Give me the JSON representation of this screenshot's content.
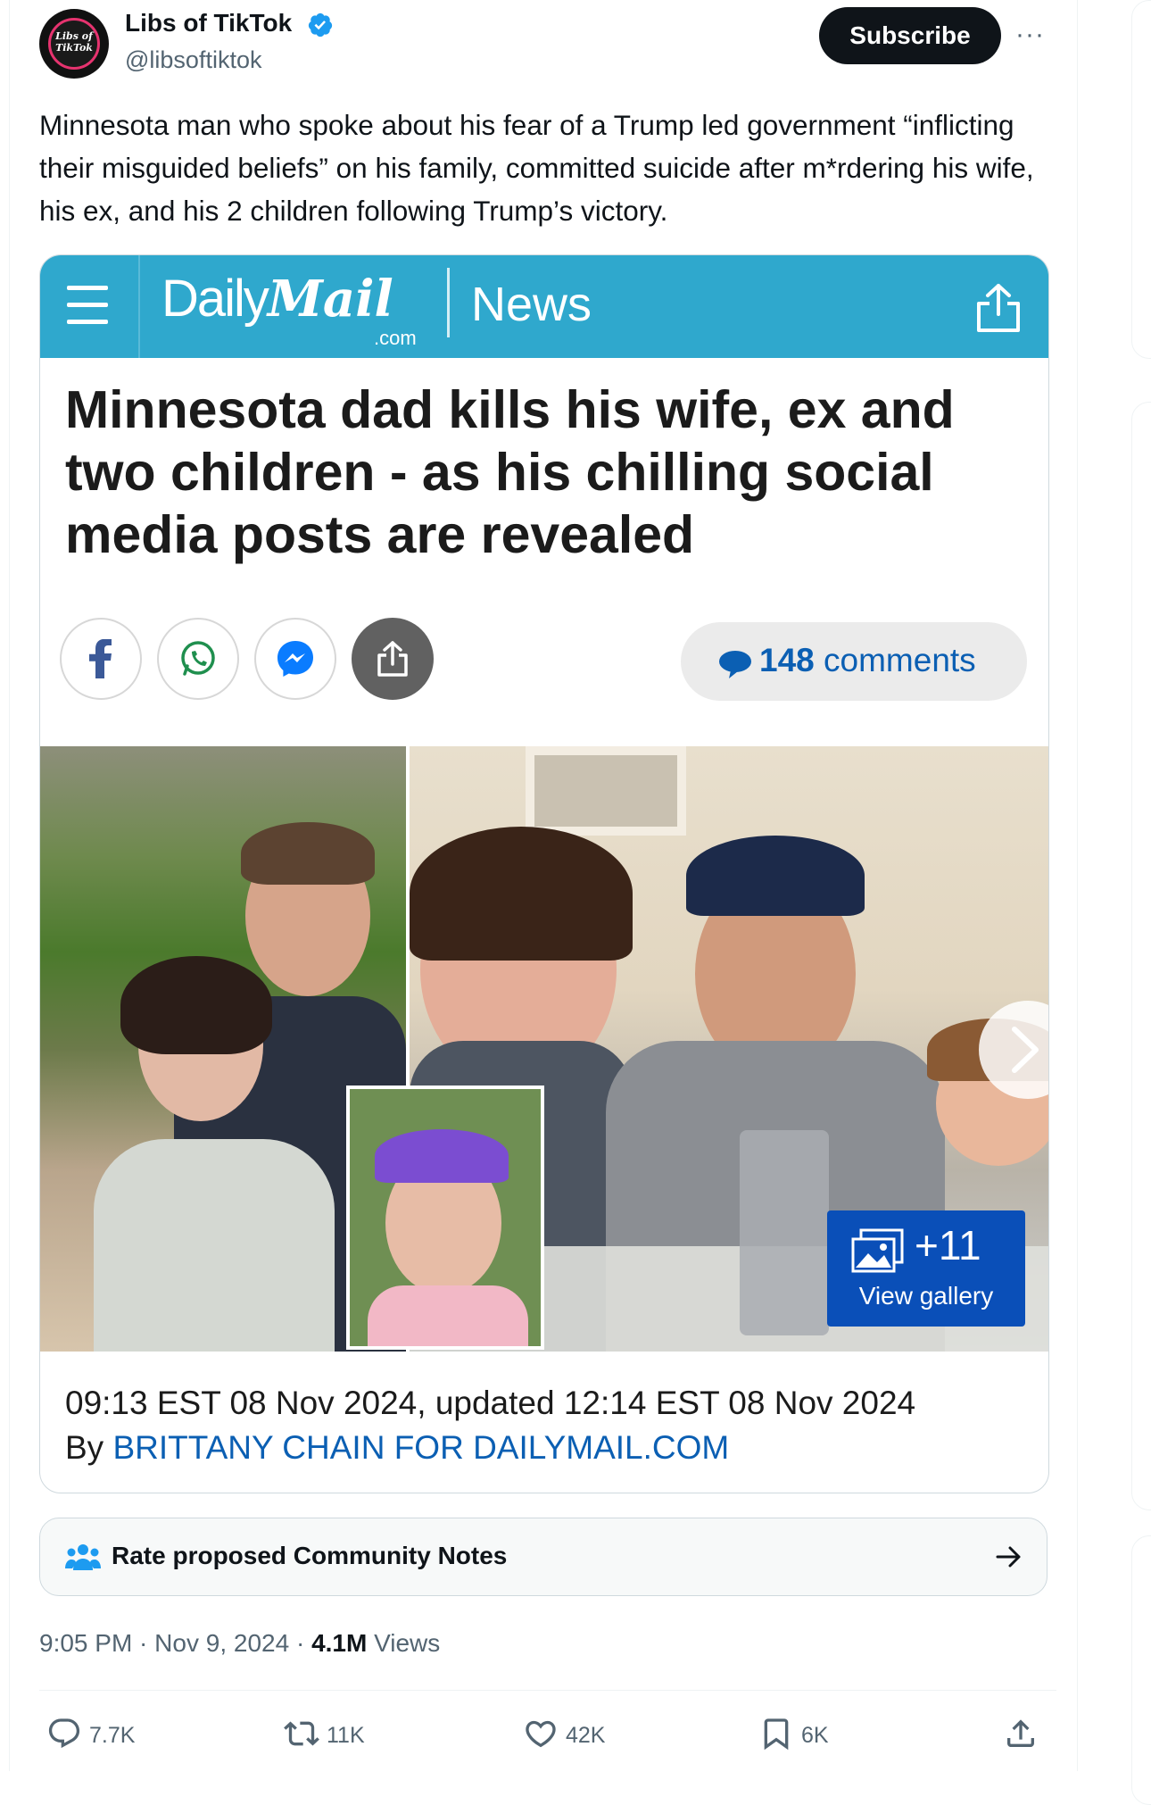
{
  "author": {
    "name": "Libs of TikTok",
    "handle": "@libsoftiktok",
    "avatar_text": "Libs of TikTok",
    "verified": true
  },
  "header": {
    "subscribe_label": "Subscribe",
    "more_label": "···"
  },
  "tweet": {
    "text": "Minnesota man who spoke about his fear of a Trump led government “inflicting their misguided beliefs” on his family, committed suicide after m*rdering his wife, his ex, and his 2 children following Trump’s victory."
  },
  "article": {
    "brand_daily": "Daily",
    "brand_mail": "Mail",
    "brand_com": ".com",
    "section": "News",
    "headline": "Minnesota dad kills his wife, ex and two children - as his chilling social media posts are revealed",
    "comments_count": "148",
    "comments_label": "comments",
    "gallery_count": "+11",
    "gallery_label": "View gallery",
    "dateline": "09:13 EST 08 Nov 2024, updated 12:14 EST 08 Nov 2024",
    "by_prefix": "By",
    "by_author": "BRITTANY CHAIN FOR DAILYMAIL.COM"
  },
  "community_notes": {
    "label": "Rate proposed Community Notes"
  },
  "meta": {
    "time": "9:05 PM",
    "date": "Nov 9, 2024",
    "views_count": "4.1M",
    "views_label": "Views"
  },
  "actions": {
    "replies": "7.7K",
    "reposts": "11K",
    "likes": "42K",
    "bookmarks": "6K"
  },
  "colors": {
    "dailymail_bar": "#2fa8cd",
    "dailymail_link": "#0b5fb3",
    "gallery_chip": "#0a4fb8",
    "verified_blue": "#1d9bf0",
    "text_primary": "#0f1419",
    "text_secondary": "#536471"
  }
}
